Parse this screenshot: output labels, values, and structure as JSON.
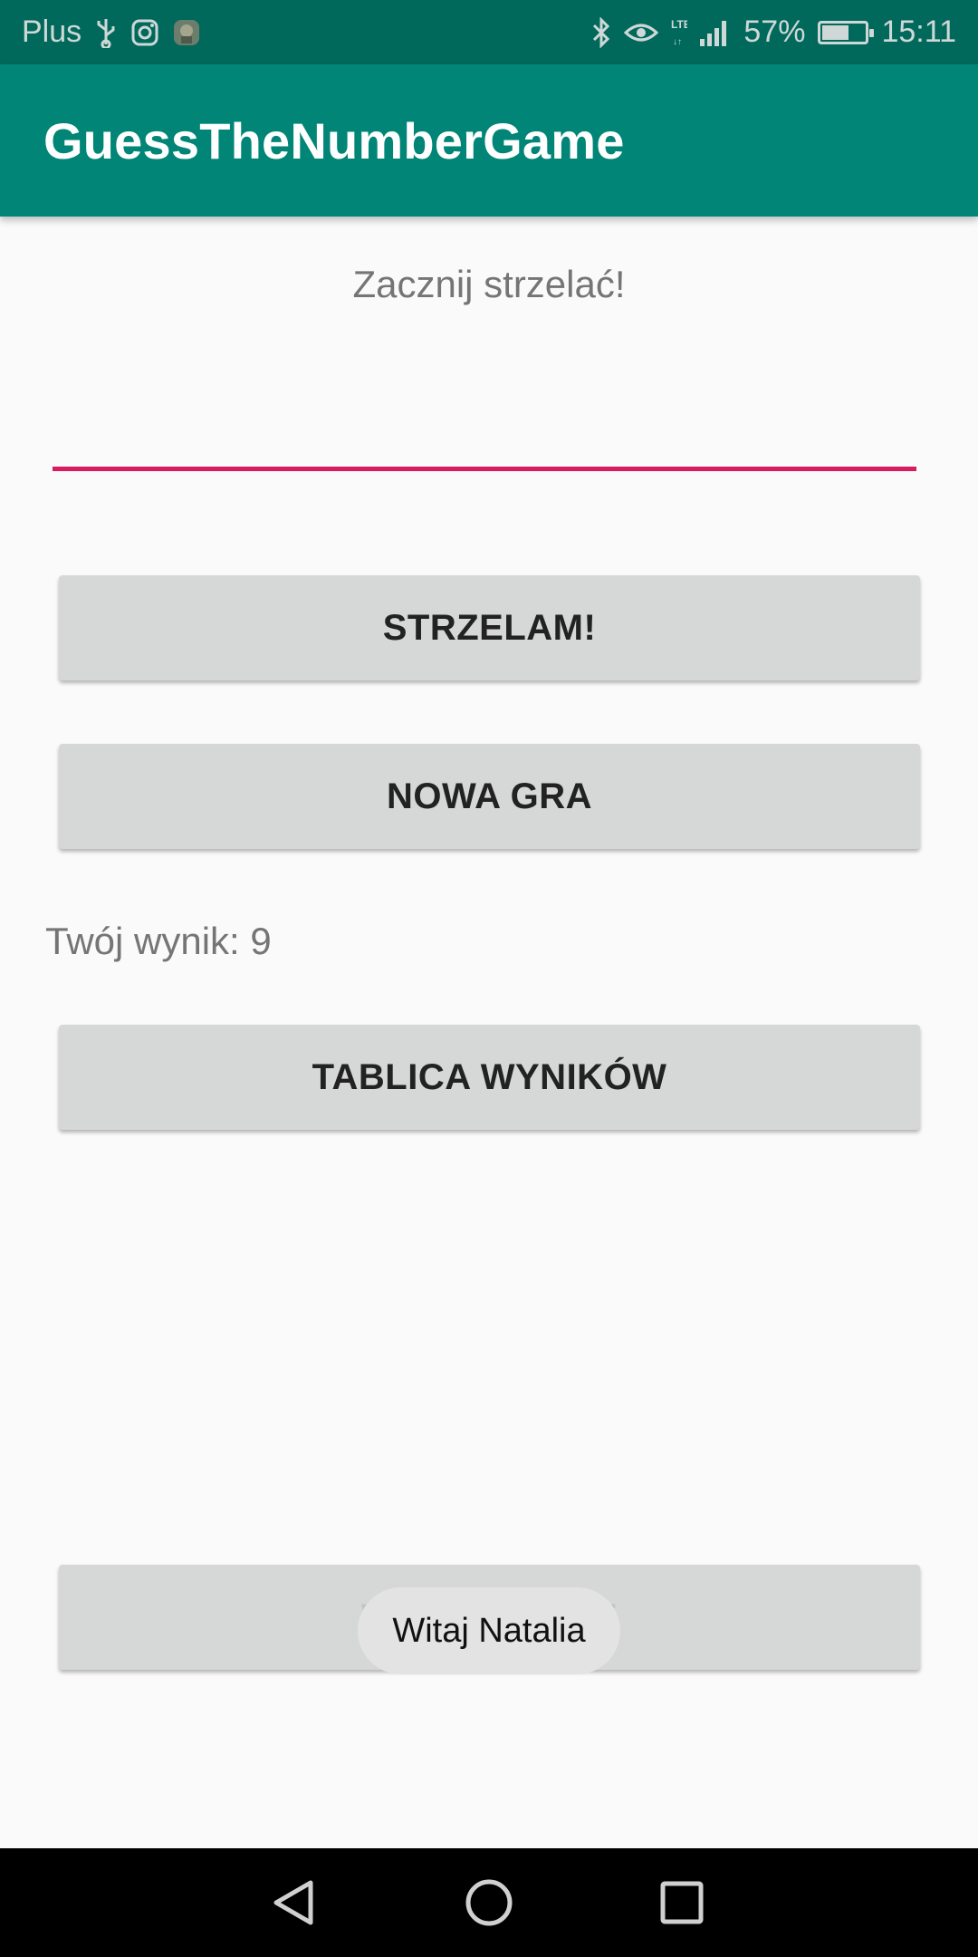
{
  "status_bar": {
    "carrier": "Plus",
    "icons_left": [
      "usb-icon",
      "instagram-icon",
      "app-notification-icon"
    ],
    "icons_right": [
      "bluetooth-icon",
      "eye-comfort-icon",
      "lte-icon",
      "signal-icon"
    ],
    "battery_percent": "57%",
    "battery_level": 0.57,
    "time": "15:11"
  },
  "app_bar": {
    "title": "GuessTheNumberGame"
  },
  "main": {
    "hint": "Zacznij strzelać!",
    "guess_input": {
      "value": "",
      "placeholder": ""
    },
    "shoot_button": "STRZELAM!",
    "new_game_button": "NOWA GRA",
    "score": "Twój wynik: 9",
    "leaderboard_button": "TABLICA WYNIKÓW",
    "logout_button": "WYLOGUJ SIĘ"
  },
  "toast": {
    "message": "Witaj Natalia"
  },
  "nav_bar": {
    "buttons": [
      "back-icon",
      "home-icon",
      "recents-icon"
    ]
  },
  "colors": {
    "status_bar": "#00695c",
    "app_bar": "#008577",
    "accent": "#d81b60",
    "button": "#d6d7d7",
    "background": "#fafafa"
  }
}
